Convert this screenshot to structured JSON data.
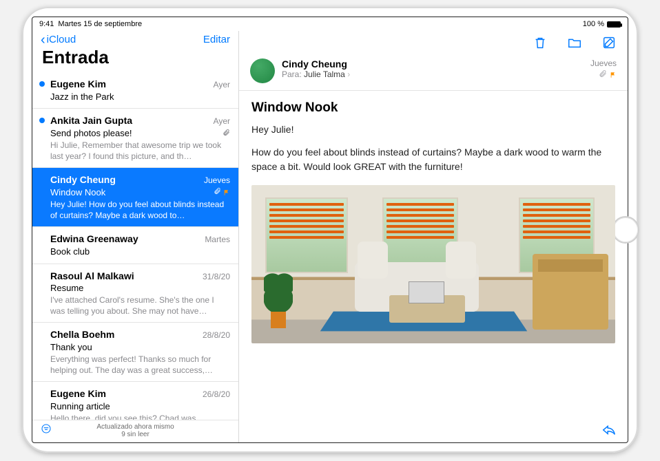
{
  "status": {
    "time": "9:41",
    "date": "Martes 15 de septiembre",
    "battery_pct": "100 %"
  },
  "nav": {
    "back_label": "iCloud",
    "edit_label": "Editar"
  },
  "mailbox_title": "Entrada",
  "footer": {
    "updated": "Actualizado ahora mismo",
    "unread": "9 sin leer"
  },
  "messages": [
    {
      "sender": "Eugene Kim",
      "date": "Ayer",
      "subject": "Jazz in the Park",
      "preview": "",
      "unread": true,
      "attach": false,
      "flag": false,
      "selected": false
    },
    {
      "sender": "Ankita Jain Gupta",
      "date": "Ayer",
      "subject": "Send photos please!",
      "preview": "Hi Julie, Remember that awesome trip we took last year? I found this picture, and th…",
      "unread": true,
      "attach": true,
      "flag": false,
      "selected": false
    },
    {
      "sender": "Cindy Cheung",
      "date": "Jueves",
      "subject": "Window Nook",
      "preview": "Hey Julie! How do you feel about blinds instead of curtains? Maybe a dark wood to…",
      "unread": false,
      "attach": true,
      "flag": true,
      "selected": true
    },
    {
      "sender": "Edwina Greenaway",
      "date": "Martes",
      "subject": "Book club",
      "preview": "",
      "unread": false,
      "attach": false,
      "flag": false,
      "selected": false
    },
    {
      "sender": "Rasoul Al Malkawi",
      "date": "31/8/20",
      "subject": "Resume",
      "preview": "I've attached Carol's resume. She's the one I was telling you about. She may not have…",
      "unread": false,
      "attach": false,
      "flag": false,
      "selected": false
    },
    {
      "sender": "Chella Boehm",
      "date": "28/8/20",
      "subject": "Thank you",
      "preview": "Everything was perfect! Thanks so much for helping out. The day was a great success,…",
      "unread": false,
      "attach": false,
      "flag": false,
      "selected": false
    },
    {
      "sender": "Eugene Kim",
      "date": "26/8/20",
      "subject": "Running article",
      "preview": "Hello there, did you see this? Chad was",
      "unread": false,
      "attach": false,
      "flag": false,
      "selected": false
    }
  ],
  "reader": {
    "from": "Cindy Cheung",
    "to_label": "Para:",
    "to_name": "Julie Talma",
    "date": "Jueves",
    "subject": "Window Nook",
    "greeting": "Hey Julie!",
    "body": "How do you feel about blinds instead of curtains? Maybe a dark wood to warm the space a bit. Would look GREAT with the furniture!",
    "has_attachment": true,
    "flagged": true
  }
}
